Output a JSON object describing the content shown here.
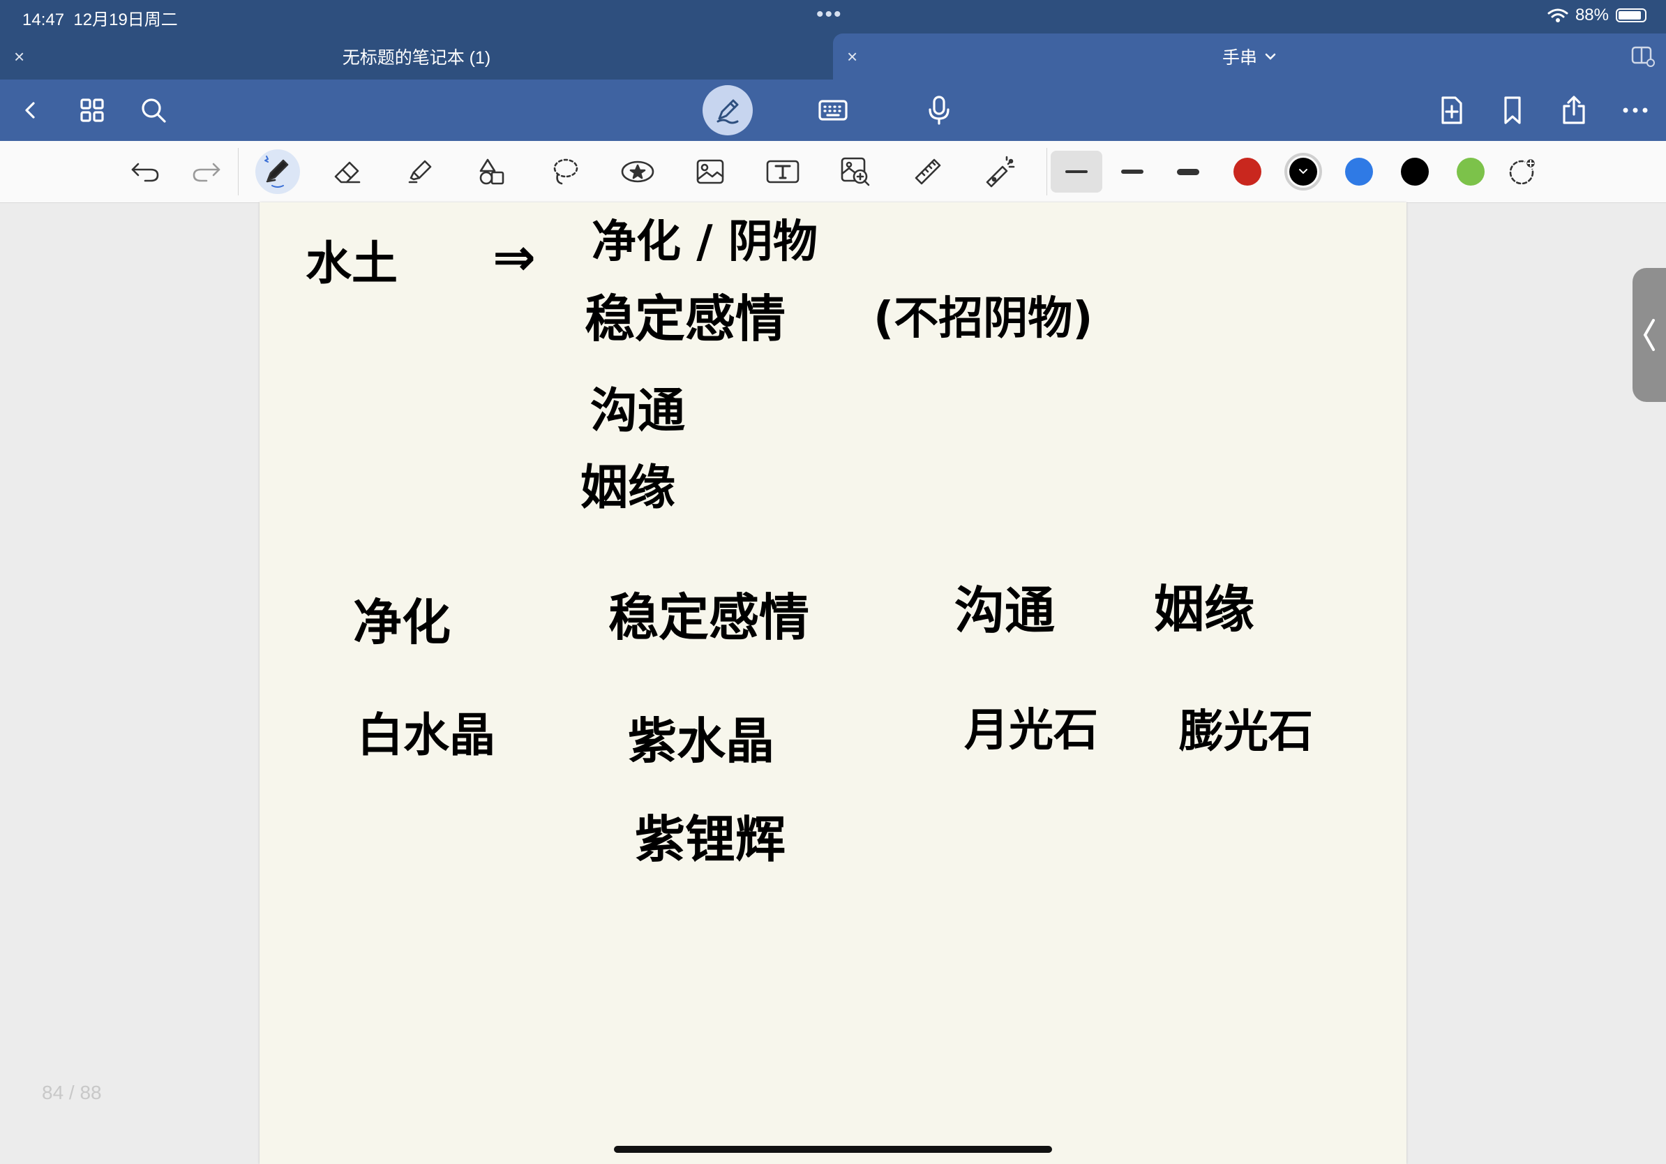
{
  "status_bar": {
    "time": "14:47",
    "date": "12月19日周二",
    "dots": "•••",
    "battery_percent": "88%",
    "battery_level": 0.88
  },
  "tabs": [
    {
      "title": "无标题的笔记本 (1)",
      "active": true,
      "close_icon": "×"
    },
    {
      "title": "手串",
      "active": false,
      "close_icon": "×",
      "dropdown_icon": "chevron-down-icon"
    }
  ],
  "nav_icons": {
    "left": [
      "back-icon",
      "grid-icon",
      "search-icon"
    ],
    "center": [
      "pen-mode-icon",
      "keyboard-icon",
      "microphone-icon"
    ],
    "right": [
      "add-page-icon",
      "bookmark-icon",
      "share-icon",
      "more-icon"
    ]
  },
  "toolbar": {
    "tools": [
      "undo-icon",
      "redo-icon",
      "pen-icon",
      "eraser-icon",
      "highlighter-icon",
      "shapes-icon",
      "lasso-icon",
      "sticker-icon",
      "image-icon",
      "text-box-icon",
      "zoom-window-icon",
      "ruler-icon",
      "laser-pointer-icon"
    ],
    "selected_tool": "pen-icon",
    "stroke_sizes": [
      "fine",
      "medium",
      "thick"
    ],
    "selected_stroke": "fine",
    "colors": [
      "#c9271e",
      "#000000",
      "#2f7ae5",
      "#000000",
      "#7cc24a"
    ],
    "selected_color_index": 1,
    "add_color_icon": "add-color-icon"
  },
  "page": {
    "counter": "84 / 88",
    "handwriting": {
      "topic": "水土",
      "arrow": "⇒",
      "list": [
        "净化 / 阴物",
        "稳定感情",
        "沟通",
        "姻缘"
      ],
      "aside": "(不招阴物)",
      "columns": [
        {
          "heading": "净化",
          "items": [
            "白水晶"
          ]
        },
        {
          "heading": "稳定感情",
          "items": [
            "紫水晶",
            "紫锂辉"
          ]
        },
        {
          "heading": "沟通",
          "items": [
            "月光石"
          ]
        },
        {
          "heading": "姻缘",
          "items": [
            "膨光石"
          ]
        }
      ]
    }
  },
  "side_handle_icon": "chevron-left-icon"
}
